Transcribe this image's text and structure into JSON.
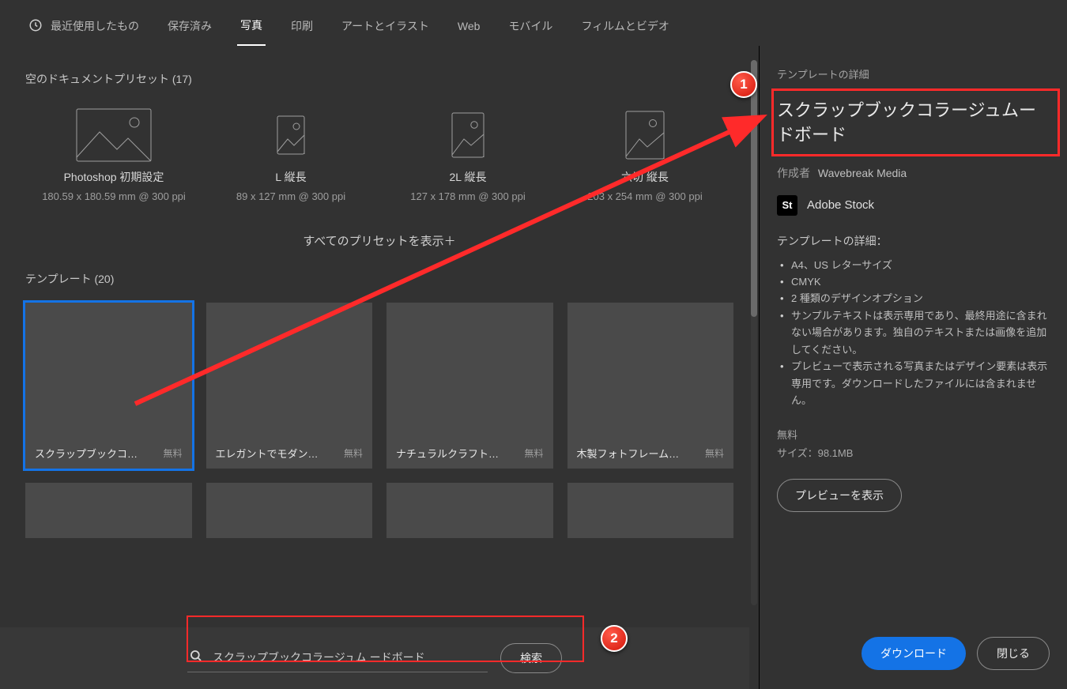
{
  "tabs": {
    "recent": "最近使用したもの",
    "saved": "保存済み",
    "photo": "写真",
    "print": "印刷",
    "art": "アートとイラスト",
    "web": "Web",
    "mobile": "モバイル",
    "film": "フィルムとビデオ"
  },
  "blank_presets_title": "空のドキュメントプリセット  (17)",
  "presets": [
    {
      "name": "Photoshop 初期設定",
      "dim": "180.59 x 180.59 mm @ 300 ppi"
    },
    {
      "name": "L 縦長",
      "dim": "89 x 127 mm @ 300 ppi"
    },
    {
      "name": "2L 縦長",
      "dim": "127 x 178 mm @ 300 ppi"
    },
    {
      "name": "六切 縦長",
      "dim": "203 x 254 mm @ 300 ppi"
    }
  ],
  "show_all": "すべてのプリセットを表示＋",
  "templates_title": "テンプレート  (20)",
  "templates": [
    {
      "name": "スクラップブックコラー…",
      "price": "無料"
    },
    {
      "name": "エレガントでモダンなム…",
      "price": "無料"
    },
    {
      "name": "ナチュラルクラフトムード…",
      "price": "無料"
    },
    {
      "name": "木製フォトフレームモッ…",
      "price": "無料"
    }
  ],
  "search": {
    "value": "スクラップブックコラージュム ードボード",
    "button": "検索"
  },
  "detail": {
    "label": "テンプレートの詳細",
    "title": "スクラップブックコラージュムードボード",
    "author_by": "作成者",
    "author_name": "Wavebreak Media",
    "stock_badge": "St",
    "stock_name": "Adobe Stock",
    "heading": "テンプレートの詳細：",
    "bullets": [
      "A4、US レターサイズ",
      "CMYK",
      "2 種類のデザインオプション",
      "サンプルテキストは表示専用であり、最終用途に含まれない場合があります。独自のテキストまたは画像を追加してください。",
      "プレビューで表示される写真またはデザイン要素は表示専用です。ダウンロードしたファイルには含まれません。"
    ],
    "free": "無料",
    "size": "サイズ：98.1MB",
    "preview_btn": "プレビューを表示",
    "download_btn": "ダウンロード",
    "close_btn": "閉じる"
  },
  "annotations": {
    "m1": "1",
    "m2": "2"
  }
}
